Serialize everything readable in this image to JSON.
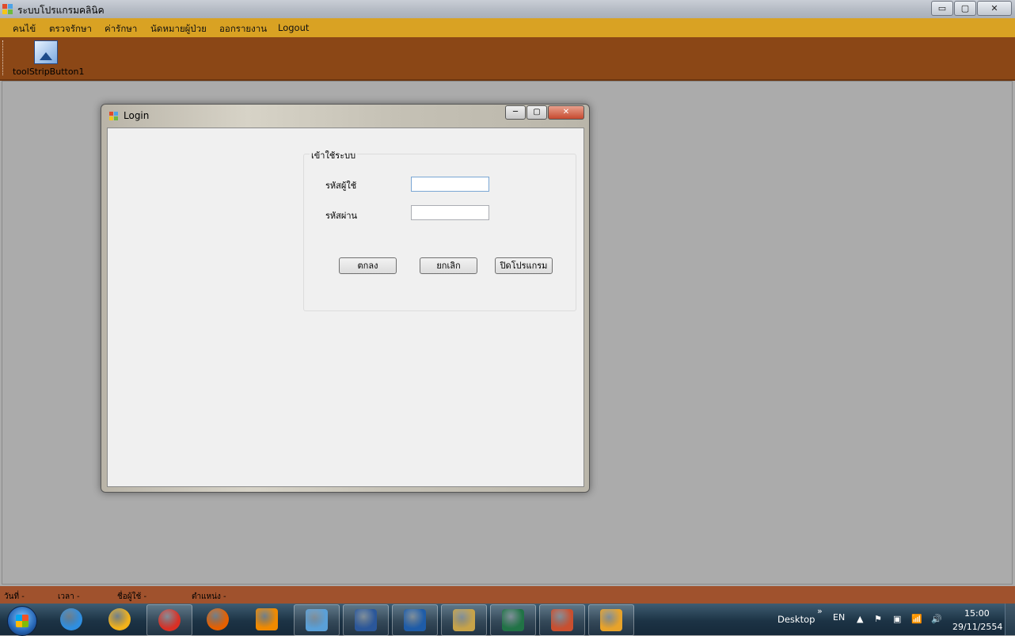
{
  "window": {
    "title": "ระบบโปรแกรมคลินิค",
    "controls": [
      "▭",
      "▢",
      "✕"
    ]
  },
  "menu": {
    "items": [
      "คนไข้",
      "ตรวจรักษา",
      "ค่ารักษา",
      "นัดหมายผู้ป่วย",
      "ออกรายงาน",
      "Logout"
    ]
  },
  "toolstrip": {
    "button_label": "toolStripButton1",
    "button_icon": "picture-icon"
  },
  "login": {
    "title": "Login",
    "group_title": "เข้าใช้ระบบ",
    "username_label": "รหัสผู้ใช้",
    "username_value": "",
    "password_label": "รหัสผ่าน",
    "password_value": "",
    "ok_button": "ตกลง",
    "cancel_button": "ยกเลิก",
    "exit_button": "ปิดโปรแกรม",
    "controls": [
      "─",
      "▢",
      "✕"
    ]
  },
  "statusbar": {
    "items": [
      "วันที่  -",
      "เวลา  -",
      "ชื่อผู้ใช้  -",
      "ตำแหน่ง  -"
    ]
  },
  "taskbar": {
    "apps": [
      {
        "name": "internet-explorer-icon",
        "color": "#2f8ee0"
      },
      {
        "name": "app-triangle-icon",
        "color": "#f2b21b"
      },
      {
        "name": "chrome-icon",
        "color": "#d93025"
      },
      {
        "name": "firefox-icon",
        "color": "#e66000"
      },
      {
        "name": "vlc-icon",
        "color": "#f08a00"
      },
      {
        "name": "people-icon",
        "color": "#5aa0d8"
      },
      {
        "name": "word-icon",
        "color": "#2b579a"
      },
      {
        "name": "document-icon",
        "color": "#1e5ca8"
      },
      {
        "name": "tools-icon",
        "color": "#c7a349"
      },
      {
        "name": "excel-icon",
        "color": "#217346"
      },
      {
        "name": "visual-studio-icon",
        "color": "#c94f2f"
      },
      {
        "name": "winforms-app-icon",
        "color": "#e8a32a"
      }
    ],
    "desktop_label": "Desktop",
    "chevron": "»",
    "language": "EN",
    "tray_icons": [
      "▲",
      "⚑",
      "▣",
      "📶",
      "🔊"
    ],
    "time": "15:00",
    "date": "29/11/2554"
  }
}
